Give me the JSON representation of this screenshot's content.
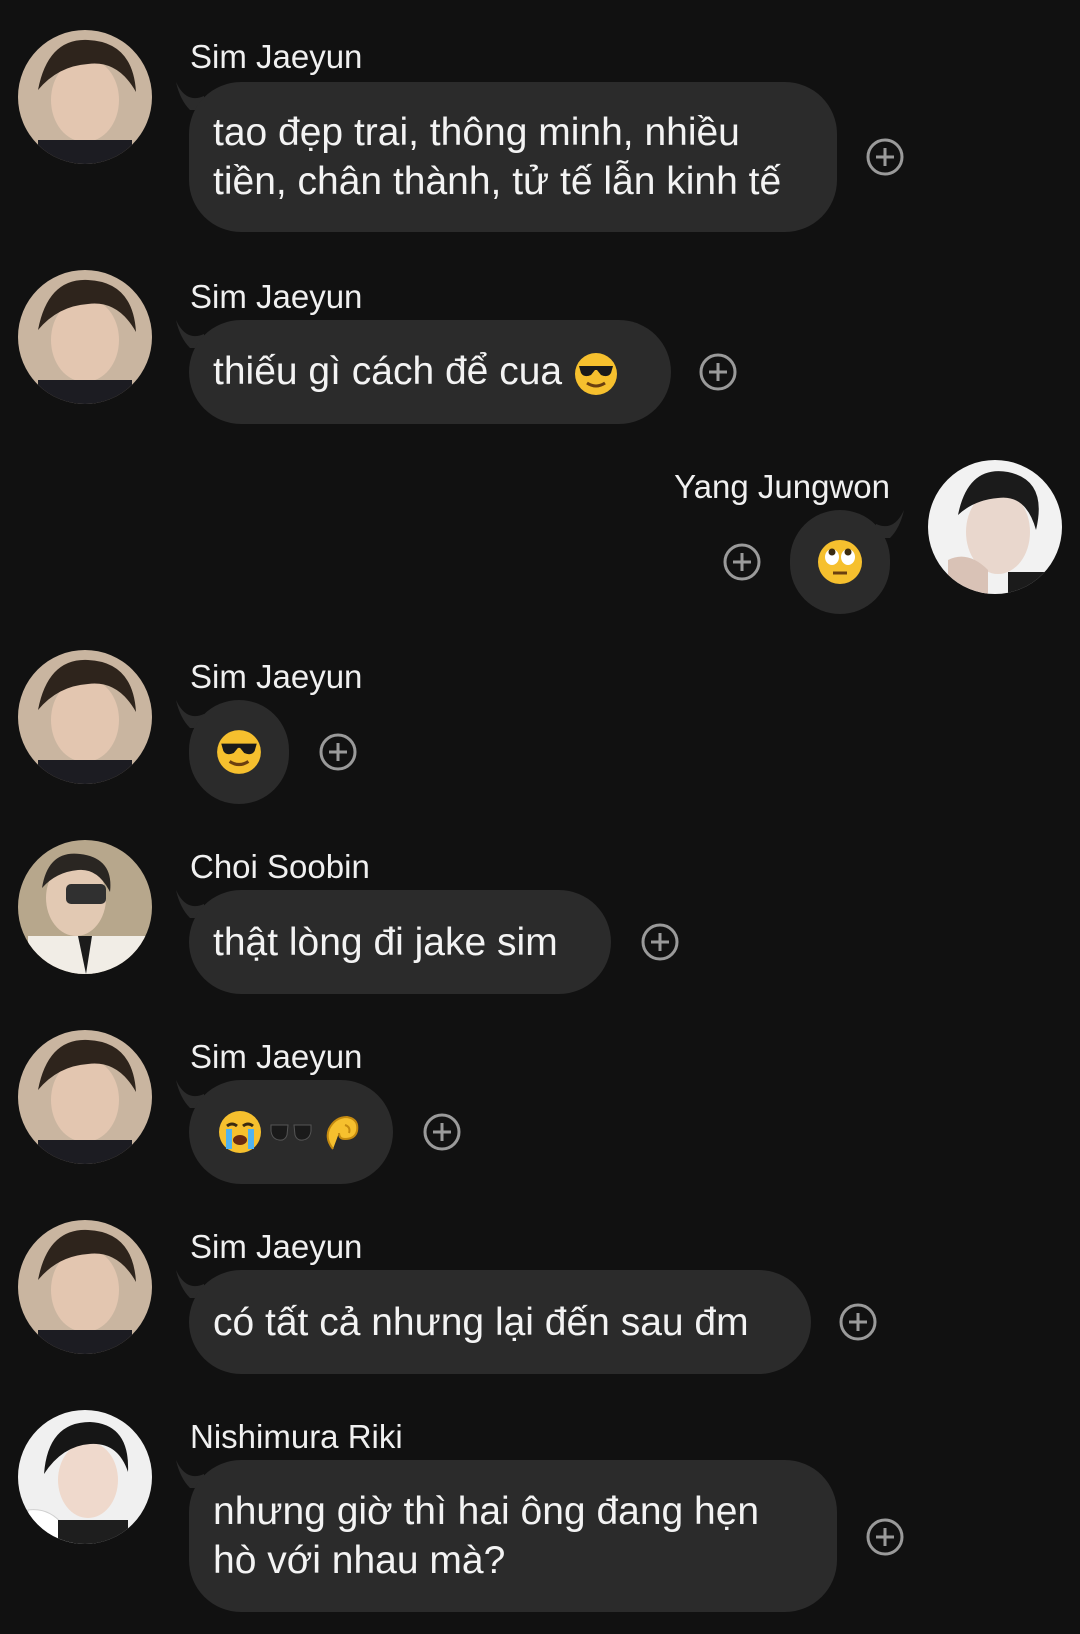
{
  "messages": [
    {
      "sender": "Sim Jaeyun",
      "lines": [
        "tao đẹp trai, thông minh, nhiều",
        "tiền, chân thành, tử tế lẫn kinh tế"
      ]
    },
    {
      "sender": "Sim Jaeyun",
      "text": "thiếu gì cách để cua",
      "emoji": "cool-face"
    },
    {
      "sender": "Yang Jungwon",
      "emoji": "eye-roll-face"
    },
    {
      "sender": "Sim Jaeyun",
      "emoji": "cool-face"
    },
    {
      "sender": "Choi Soobin",
      "text": "thật lòng đi jake sim"
    },
    {
      "sender": "Sim Jaeyun",
      "emojis": [
        "crying-face",
        "sunglasses",
        "pinched-fingers"
      ]
    },
    {
      "sender": "Sim Jaeyun",
      "text": "có tất cả nhưng lại đến sau đm"
    },
    {
      "sender": "Nishimura Riki",
      "lines": [
        "nhưng giờ thì hai ông đang hẹn",
        "hò với nhau mà?"
      ]
    }
  ],
  "colors": {
    "background": "#111111",
    "bubble": "#2b2b2b",
    "text": "#f3f3f3",
    "react_icon": "#9a9a9a"
  }
}
